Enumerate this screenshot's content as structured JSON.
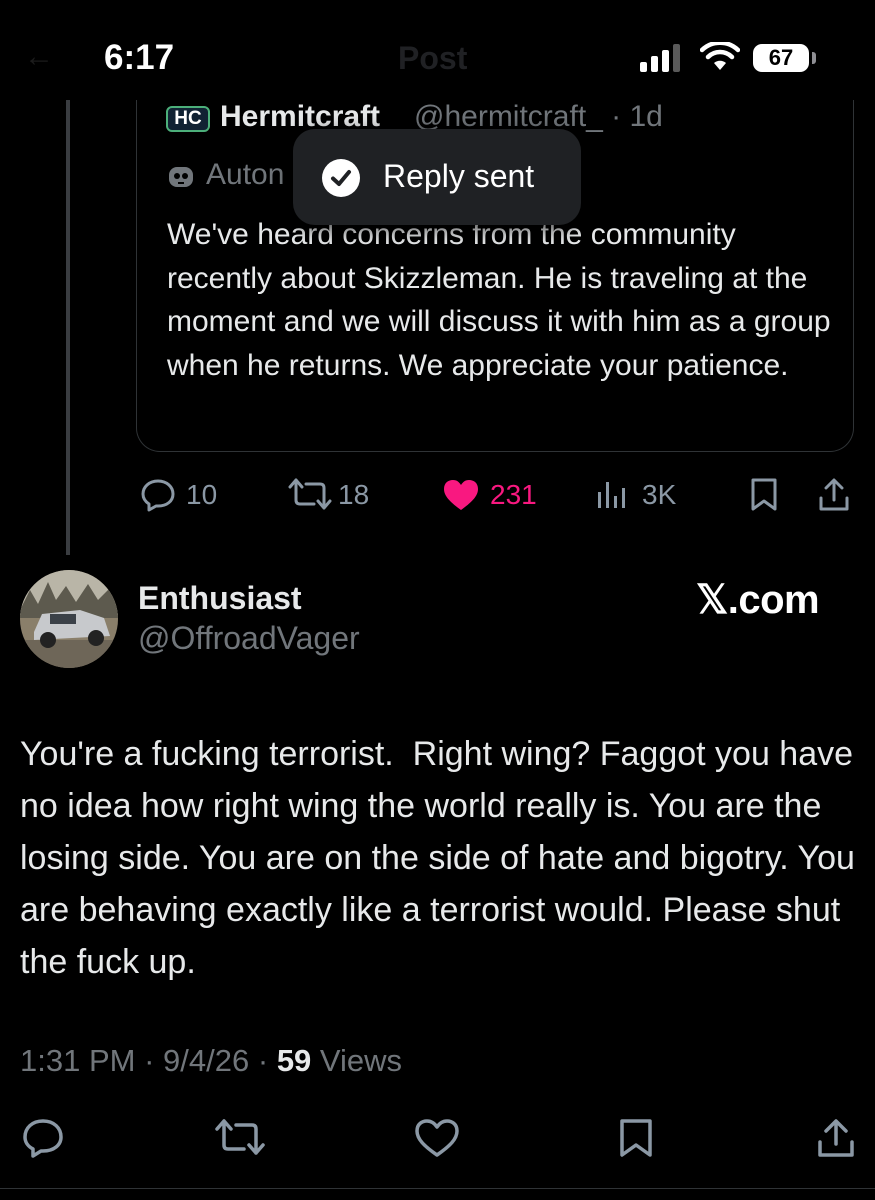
{
  "status_bar": {
    "time": "6:17",
    "battery": "67",
    "header_title": "Post",
    "icons": [
      "signal-icon",
      "wifi-icon",
      "battery-icon"
    ]
  },
  "toast": {
    "label": "Reply sent",
    "icon": "check-circle-icon"
  },
  "quoted_post": {
    "logo_text": "HC",
    "author_name": "Hermitcraft",
    "handle_time": "@hermitcraft_ · 1d",
    "automated_label": "Auton",
    "text": "We've heard concerns from the community recently about Skizzleman. He is traveling at the moment and we will discuss it with him as a group when he returns. We appreciate your patience.",
    "actions": {
      "replies": "10",
      "reposts": "18",
      "likes": "231",
      "views": "3K"
    },
    "colors": {
      "like": "#f91880",
      "muted": "#8b98a5"
    }
  },
  "main_post": {
    "author_name": "Enthusiast",
    "handle": "@OffroadVager",
    "watermark": "𝕏.com",
    "text": "You're a fucking terrorist.  Right wing? Faggot you have no idea how right wing the world really is. You are the losing side. You are on the side of hate and bigotry. You are behaving exactly like a terrorist would. Please shut the fuck up.",
    "meta": {
      "time": "1:31 PM",
      "date": "9/4/26",
      "views_count": "59",
      "views_label": "Views",
      "separator": "·"
    },
    "actions": [
      "reply-icon",
      "repost-icon",
      "like-icon",
      "bookmark-icon",
      "share-icon"
    ]
  }
}
